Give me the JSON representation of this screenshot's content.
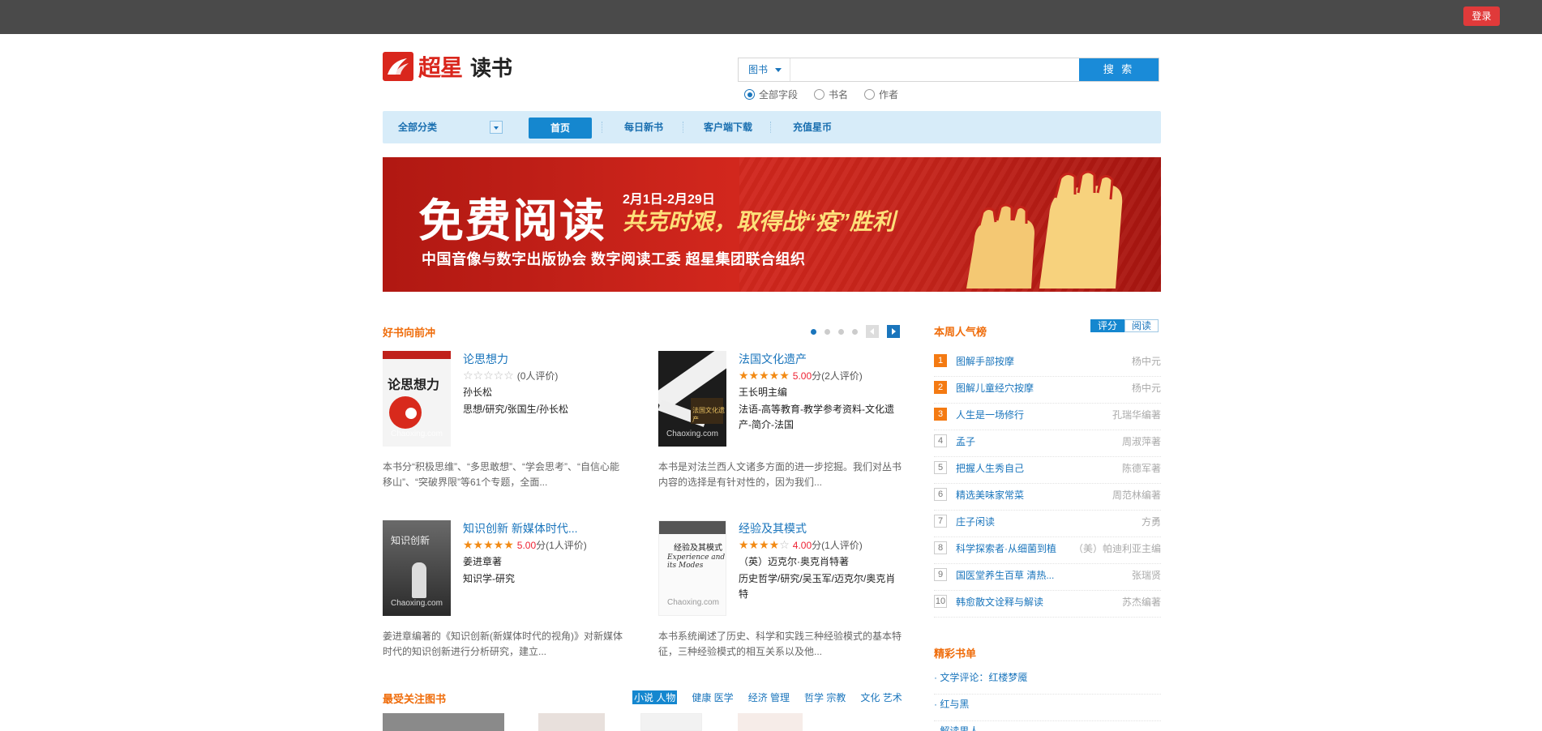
{
  "topbar": {
    "login": "登录"
  },
  "header": {
    "brand": "超星",
    "sub": "读书"
  },
  "search": {
    "type": "图书",
    "placeholder": "",
    "button": "搜 索",
    "options": [
      "全部字段",
      "书名",
      "作者"
    ],
    "selected_index": 0
  },
  "nav": {
    "category": "全部分类",
    "items": [
      "首页",
      "每日新书",
      "客户端下载",
      "充值星币"
    ],
    "active_index": 0
  },
  "banner": {
    "title": "免费阅读",
    "date": "2月1日-2月29日",
    "slogan": "共克时艰，取得战“疫”胜利",
    "org": "中国音像与数字出版协会  数字阅读工委  超星集团联合组织"
  },
  "featured": {
    "heading": "好书向前冲",
    "books": [
      {
        "title": "论思想力",
        "stars": 0,
        "score": "",
        "reviews": "(0人评价)",
        "author": "孙长松",
        "tags": "思想/研究/张国生/孙长松",
        "desc": "本书分“积极思维”、“多思敢想”、“学会思考”、“自信心能移山”、“突破界限”等61个专题，全面...",
        "cover_text": "论思想力",
        "watermark": "Chaoxing.com"
      },
      {
        "title": "法国文化遗产",
        "stars": 5,
        "score": "5.00",
        "reviews": "分(2人评价)",
        "author": "王长明主编",
        "tags": "法语-高等教育-教学参考资料-文化遗产-简介-法国",
        "desc": "本书是对法兰西人文诸多方面的进一步挖掘。我们对丛书内容的选择是有针对性的，因为我们...",
        "cover_text": "法国文化遗产",
        "watermark": "Chaoxing.com"
      },
      {
        "title": "知识创新 新媒体时代...",
        "stars": 5,
        "score": "5.00",
        "reviews": "分(1人评价)",
        "author": "姜进章著",
        "tags": "知识学-研究",
        "desc": "姜进章编著的《知识创新(新媒体时代的视角)》对新媒体时代的知识创新进行分析研究，建立...",
        "cover_text": "知识创新",
        "watermark": "Chaoxing.com"
      },
      {
        "title": "经验及其模式",
        "stars": 4,
        "score": "4.00",
        "reviews": "分(1人评价)",
        "author": "（英）迈克尔·奥克肖特著",
        "tags": "历史哲学/研究/吴玉军/迈克尔/奥克肖特",
        "desc": "本书系统阐述了历史、科学和实践三种经验模式的基本特征，三种经验模式的相互关系以及他...",
        "cover_text": "经验及其模式",
        "watermark": "Chaoxing.com"
      }
    ]
  },
  "weekly": {
    "heading": "本周人气榜",
    "tabs": [
      "评分",
      "阅读"
    ],
    "active_tab": 0,
    "items": [
      {
        "rank": "1",
        "name": "图解手部按摩",
        "author": "杨中元"
      },
      {
        "rank": "2",
        "name": "图解儿童经穴按摩",
        "author": "杨中元"
      },
      {
        "rank": "3",
        "name": "人生是一场修行",
        "author": "孔瑞华编著"
      },
      {
        "rank": "4",
        "name": "孟子",
        "author": "周淑萍著"
      },
      {
        "rank": "5",
        "name": "把握人生秀自己",
        "author": "陈德军著"
      },
      {
        "rank": "6",
        "name": "精选美味家常菜",
        "author": "周范林编著"
      },
      {
        "rank": "7",
        "name": "庄子闲读",
        "author": "方勇"
      },
      {
        "rank": "8",
        "name": "科学探索者·从细菌到植",
        "author": "（美）帕迪利亚主编"
      },
      {
        "rank": "9",
        "name": "国医堂养生百草 清热...",
        "author": "张瑞贤"
      },
      {
        "rank": "10",
        "name": "韩愈散文诠释与解读",
        "author": "苏杰编著"
      }
    ]
  },
  "booklists": {
    "heading": "精彩书单",
    "items": [
      "· 文学评论：红楼梦魇",
      "· 红与黑",
      "· 解读男人"
    ]
  },
  "popular": {
    "heading": "最受关注图书",
    "tabs": [
      "小说 人物",
      "健康 医学",
      "经济 管理",
      "哲学 宗教",
      "文化 艺术"
    ],
    "active_tab": 0
  },
  "colors": {
    "accent": "#1587cf",
    "orange": "#ef6c0a",
    "login": "#e03a3a",
    "banner": "#c4231a"
  }
}
